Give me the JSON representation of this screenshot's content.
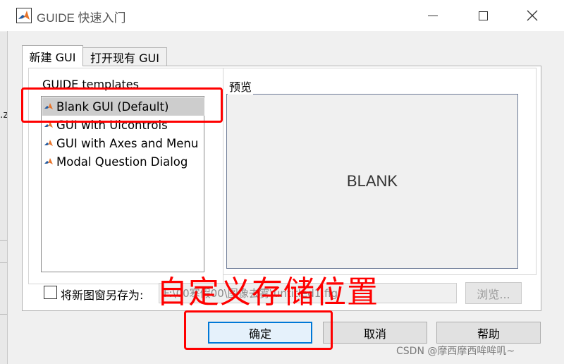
{
  "window": {
    "title": "GUIDE 快速入门",
    "colors": {
      "titlebar": "#ffffff",
      "body": "#f0f0f0",
      "accent": "#0078d7",
      "annotation": "#ff0000"
    }
  },
  "background": {
    "left_fragment": ".z"
  },
  "tabs": [
    {
      "label": "新建 GUI",
      "active": true
    },
    {
      "label": "打开现有 GUI",
      "active": false
    }
  ],
  "templates": {
    "label": "GUIDE templates",
    "items": [
      {
        "label": "Blank GUI (Default)",
        "selected": true
      },
      {
        "label": "GUI with Uicontrols",
        "selected": false
      },
      {
        "label": "GUI with Axes and Menu",
        "selected": false
      },
      {
        "label": "Modal Question Dialog",
        "selected": false
      }
    ]
  },
  "preview": {
    "label": "预览",
    "content": "BLANK"
  },
  "save": {
    "checkbox_label": "将新图窗另存为:",
    "checked": false,
    "path": "F:\\00寒假00\\图像去雾\\untitled1.fig",
    "browse_label": "浏览..."
  },
  "buttons": {
    "ok": "确定",
    "cancel": "取消",
    "help": "帮助"
  },
  "annotation": {
    "text": "自定义存储位置"
  },
  "watermark": "CSDN @摩西摩西哞哞叽~"
}
